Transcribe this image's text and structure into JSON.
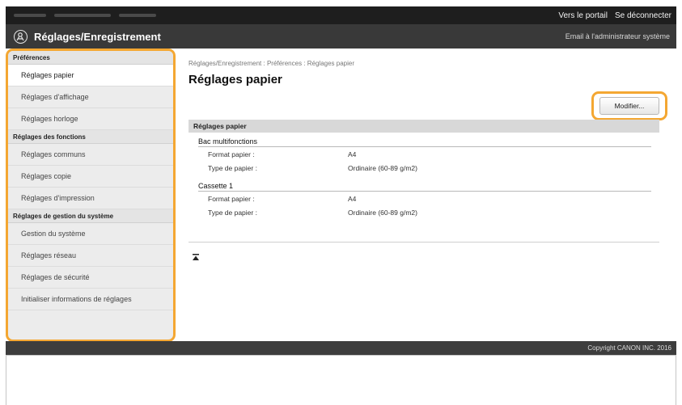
{
  "topbar": {
    "portal_link": "Vers le portail",
    "logout_link": "Se déconnecter"
  },
  "header": {
    "app_title": "Réglages/Enregistrement",
    "admin_email_link": "Email à l'administrateur système"
  },
  "sidebar": {
    "sections": [
      {
        "title": "Préférences",
        "items": [
          {
            "label": "Réglages papier",
            "active": true
          },
          {
            "label": "Réglages d'affichage"
          },
          {
            "label": "Réglages horloge"
          }
        ]
      },
      {
        "title": "Réglages des fonctions",
        "items": [
          {
            "label": "Réglages communs"
          },
          {
            "label": "Réglages copie"
          },
          {
            "label": "Réglages d'impression"
          }
        ]
      },
      {
        "title": "Réglages de gestion du système",
        "items": [
          {
            "label": "Gestion du système"
          },
          {
            "label": "Réglages réseau"
          },
          {
            "label": "Réglages de sécurité"
          },
          {
            "label": "Initialiser informations de réglages"
          }
        ]
      }
    ]
  },
  "main": {
    "breadcrumb": "Réglages/Enregistrement : Préférences : Réglages papier",
    "page_title": "Réglages papier",
    "modify_label": "Modifier...",
    "section_header": "Réglages papier",
    "groups": [
      {
        "title": "Bac multifonctions",
        "rows": [
          {
            "label": "Format papier :",
            "value": "A4"
          },
          {
            "label": "Type de papier :",
            "value": "Ordinaire (60-89 g/m2)"
          }
        ]
      },
      {
        "title": "Cassette 1",
        "rows": [
          {
            "label": "Format papier :",
            "value": "A4"
          },
          {
            "label": "Type de papier :",
            "value": "Ordinaire (60-89 g/m2)"
          }
        ]
      }
    ]
  },
  "footer": {
    "copyright": "Copyright CANON INC. 2016"
  },
  "icons": {
    "app": "settings-register-icon",
    "back_to_top": "back-to-top-icon"
  },
  "colors": {
    "highlight": "#f4a732",
    "topbar": "#1e1e1e",
    "header": "#393939",
    "sidebar": "#ececec"
  }
}
